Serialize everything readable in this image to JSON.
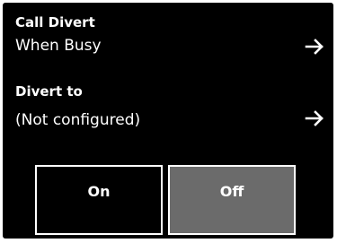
{
  "call_divert": {
    "heading": "Call Divert",
    "value": "When Busy",
    "arrow_icon": "arrow-right-icon"
  },
  "divert_to": {
    "heading": "Divert to",
    "value": "(Not configured)",
    "arrow_icon": "arrow-right-icon"
  },
  "buttons": {
    "on_label": "On",
    "off_label": "Off"
  },
  "colors": {
    "background": "#000000",
    "text": "#ffffff",
    "selected_button": "#6b6b6b"
  }
}
